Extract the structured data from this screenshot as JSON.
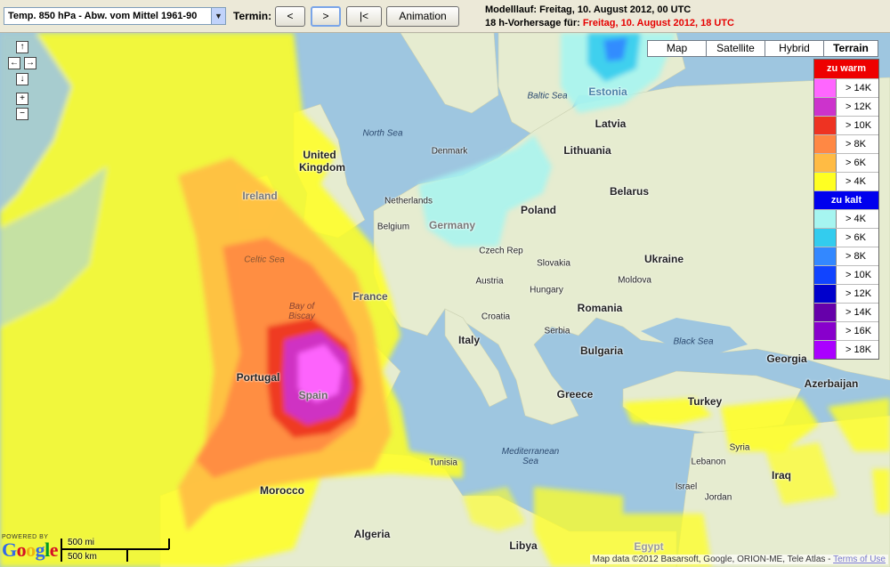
{
  "toolbar": {
    "parameter_select": "Temp. 850 hPa - Abw. vom Mittel 1961-90",
    "termin_label": "Termin:",
    "prev_label": "<",
    "next_label": ">",
    "first_label": "|<",
    "animation_label": "Animation",
    "modelllauf_text": "Modelllauf: Freitag, 10. August 2012, 00 UTC",
    "vorhersage_prefix": "18 h-Vorhersage für: ",
    "vorhersage_time": "Freitag, 10. August 2012, 18 UTC"
  },
  "map_types": [
    "Map",
    "Satellite",
    "Hybrid",
    "Terrain"
  ],
  "map_type_selected": "Terrain",
  "legend": {
    "warm_header": "zu warm",
    "cold_header": "zu kalt",
    "warm_header_color": "#ee0000",
    "cold_header_color": "#0000ee",
    "warm": [
      {
        "label": "> 14K",
        "color": "#ff66ff"
      },
      {
        "label": "> 12K",
        "color": "#cc33cc"
      },
      {
        "label": "> 10K",
        "color": "#ee3322"
      },
      {
        "label": "> 8K",
        "color": "#ff8844"
      },
      {
        "label": "> 6K",
        "color": "#ffbb44"
      },
      {
        "label": "> 4K",
        "color": "#ffff22"
      }
    ],
    "cold": [
      {
        "label": "> 4K",
        "color": "#a6f5f0"
      },
      {
        "label": "> 6K",
        "color": "#33ccee"
      },
      {
        "label": "> 8K",
        "color": "#3388ff"
      },
      {
        "label": "> 10K",
        "color": "#1144ff"
      },
      {
        "label": "> 12K",
        "color": "#0000cc"
      },
      {
        "label": "> 14K",
        "color": "#6600aa"
      },
      {
        "label": "> 16K",
        "color": "#8800cc"
      },
      {
        "label": "> 18K",
        "color": "#aa00ff"
      }
    ]
  },
  "map_labels": {
    "countries": [
      "United",
      "Kingdom",
      "Ireland",
      "France",
      "Portugal",
      "Spain",
      "Morocco",
      "Algeria",
      "Tunisia",
      "Libya",
      "Egypt",
      "Italy",
      "Germany",
      "Denmark",
      "Netherlands",
      "Belgium",
      "Poland",
      "Czech Rep",
      "Slovakia",
      "Austria",
      "Hungary",
      "Croatia",
      "Serbia",
      "Romania",
      "Bulgaria",
      "Greece",
      "Turkey",
      "Ukraine",
      "Moldova",
      "Belarus",
      "Lithuania",
      "Latvia",
      "Estonia",
      "Georgia",
      "Azerbaijan",
      "Syria",
      "Lebanon",
      "Israel",
      "Jordan",
      "Iraq"
    ],
    "seas": [
      "North Sea",
      "Baltic Sea",
      "Celtic Sea",
      "Bay of Biscay",
      "Black Sea",
      "Mediterranean Sea"
    ]
  },
  "controls": {
    "pan_up": "↑",
    "pan_left": "←",
    "pan_right": "→",
    "pan_down": "↓",
    "zoom_in": "+",
    "zoom_out": "−"
  },
  "footer": {
    "powered_by": "POWERED BY",
    "google": "Google",
    "scale_mi": "500 mi",
    "scale_km": "500 km",
    "copyright": "Map data ©2012 Basarsoft, Google, ORION-ME, Tele Atlas - ",
    "terms": "Terms of Use"
  }
}
